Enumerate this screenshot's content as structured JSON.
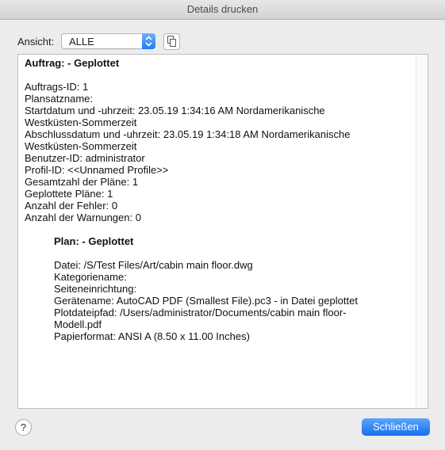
{
  "window": {
    "title": "Details drucken"
  },
  "toolbar": {
    "view_label": "Ansicht:",
    "view_selected": "ALLE",
    "copy_icon": "copy-icon",
    "arrows_icon": "updown-arrows-icon"
  },
  "details": {
    "job_header": "Auftrag: - Geplottet",
    "job_lines": [
      "Auftrags-ID: 1",
      "Plansatzname:",
      "Startdatum und -uhrzeit: 23.05.19 1:34:16 AM Nordamerikanische",
      "Westküsten-Sommerzeit",
      "Abschlussdatum und -uhrzeit: 23.05.19 1:34:18 AM Nordamerikanische",
      "Westküsten-Sommerzeit",
      "Benutzer-ID: administrator",
      "Profil-ID: <<Unnamed Profile>>",
      "Gesamtzahl der Pläne: 1",
      "Geplottete Pläne: 1",
      "Anzahl der Fehler: 0",
      "Anzahl der Warnungen: 0"
    ],
    "plan_header": "Plan: - Geplottet",
    "plan_lines": [
      "Datei: /S/Test Files/Art/cabin main floor.dwg",
      "Kategoriename:",
      "Seiteneinrichtung:",
      "Gerätename: AutoCAD PDF (Smallest File).pc3 - in Datei geplottet",
      "Plotdateipfad: /Users/administrator/Documents/cabin main floor-",
      "Modell.pdf",
      "Papierformat: ANSI A (8.50 x 11.00 Inches)"
    ]
  },
  "footer": {
    "help_label": "?",
    "close_label": "Schließen"
  },
  "colors": {
    "accent": "#1f7cf6",
    "background": "#ececec"
  }
}
